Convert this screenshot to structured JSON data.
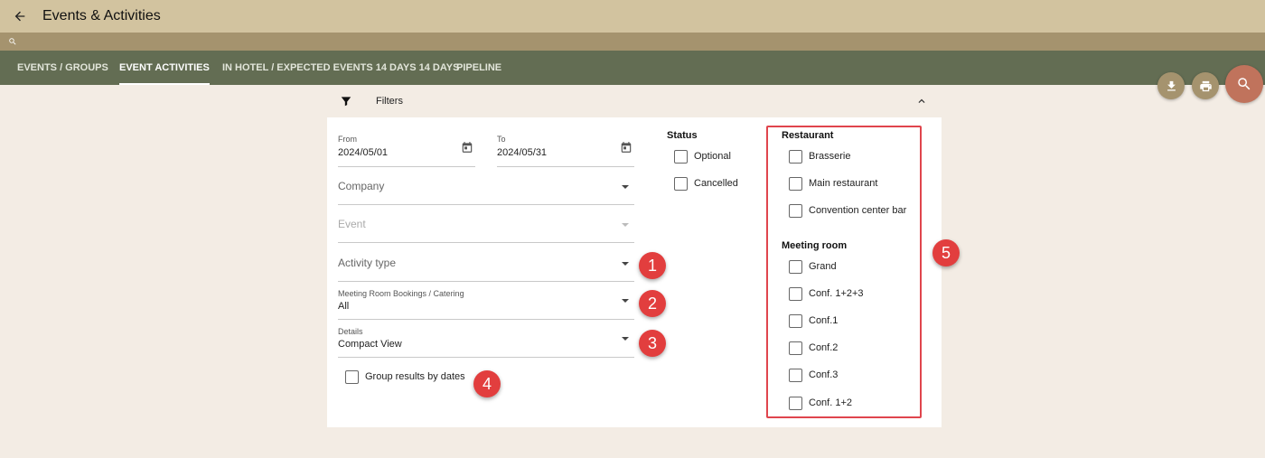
{
  "header": {
    "title": "Events & Activities",
    "back_icon": "arrow-left-icon"
  },
  "search_bar": {
    "icon": "search-icon"
  },
  "nav": {
    "tabs": [
      {
        "label": "EVENTS / GROUPS",
        "active": false
      },
      {
        "label": "EVENT ACTIVITIES",
        "active": true
      },
      {
        "label": "IN HOTEL / EXPECTED EVENTS 14 DAYS 14 DAYS",
        "active": false
      },
      {
        "label": "PIPELINE",
        "active": false
      }
    ]
  },
  "actions": {
    "download_icon": "download-icon",
    "print_icon": "print-icon",
    "search_icon": "search-icon"
  },
  "filters": {
    "title": "Filters",
    "from": {
      "label": "From",
      "value": "2024/05/01"
    },
    "to": {
      "label": "To",
      "value": "2024/05/31"
    },
    "company": {
      "placeholder": "Company"
    },
    "event": {
      "placeholder": "Event"
    },
    "activity_type": {
      "placeholder": "Activity type"
    },
    "meeting_room_bookings": {
      "label": "Meeting Room Bookings / Catering",
      "value": "All"
    },
    "details": {
      "label": "Details",
      "value": "Compact View"
    },
    "group_by_dates": {
      "label": "Group results by dates",
      "checked": false
    },
    "status": {
      "title": "Status",
      "options": [
        {
          "label": "Optional",
          "checked": false
        },
        {
          "label": "Cancelled",
          "checked": false
        }
      ]
    },
    "restaurant": {
      "title": "Restaurant",
      "options": [
        {
          "label": "Brasserie",
          "checked": false
        },
        {
          "label": "Main restaurant",
          "checked": false
        },
        {
          "label": "Convention center bar",
          "checked": false
        }
      ]
    },
    "meeting_room": {
      "title": "Meeting room",
      "options": [
        {
          "label": "Grand",
          "checked": false
        },
        {
          "label": "Conf. 1+2+3",
          "checked": false
        },
        {
          "label": "Conf.1",
          "checked": false
        },
        {
          "label": "Conf.2",
          "checked": false
        },
        {
          "label": "Conf.3",
          "checked": false
        },
        {
          "label": "Conf. 1+2",
          "checked": false
        }
      ]
    }
  },
  "callouts": [
    "1",
    "2",
    "3",
    "4",
    "5"
  ],
  "colors": {
    "title_bar": "#d2c39f",
    "search_bar": "#a5936e",
    "nav_bar": "#636d53",
    "background": "#f3ece4",
    "fab": "#a5936e",
    "fab_search": "#c0735c",
    "callout": "#e23e3e"
  }
}
